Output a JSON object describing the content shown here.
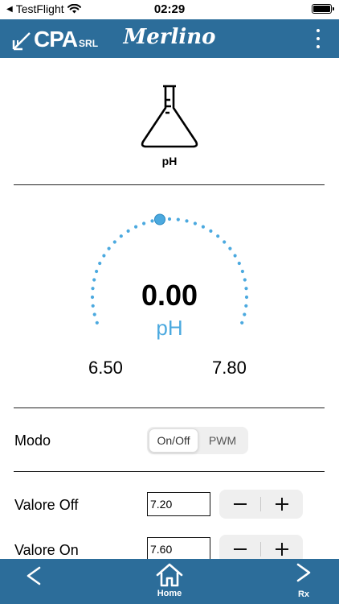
{
  "status_bar": {
    "carrier": "TestFlight",
    "time": "02:29"
  },
  "header": {
    "logo_text": "CPA",
    "logo_suffix": "SRL",
    "title": "Merlino"
  },
  "sensor": {
    "label": "pH",
    "icon": "flask-icon"
  },
  "gauge": {
    "value": "0.00",
    "unit": "pH",
    "min_label": "6.50",
    "max_label": "7.80",
    "accent_color": "#4ba9df"
  },
  "mode": {
    "label": "Modo",
    "options": [
      "On/Off",
      "PWM"
    ],
    "selected": "On/Off"
  },
  "values": [
    {
      "label": "Valore Off",
      "value": "7.20"
    },
    {
      "label": "Valore On",
      "value": "7.60"
    }
  ],
  "bottom_nav": {
    "home_label": "Home",
    "next_label": "Rx"
  },
  "colors": {
    "bar": "#2c6d9a",
    "accent": "#4ba9df"
  }
}
